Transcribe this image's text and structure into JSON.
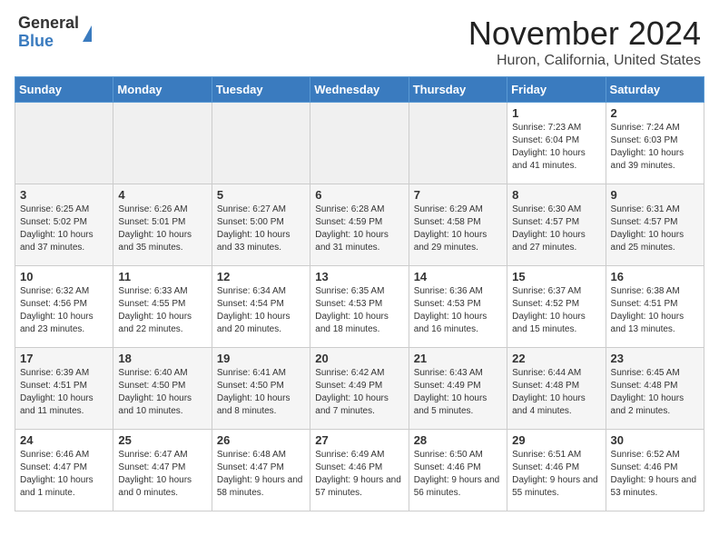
{
  "header": {
    "logo_line1": "General",
    "logo_line2": "Blue",
    "title": "November 2024",
    "subtitle": "Huron, California, United States"
  },
  "weekdays": [
    "Sunday",
    "Monday",
    "Tuesday",
    "Wednesday",
    "Thursday",
    "Friday",
    "Saturday"
  ],
  "weeks": [
    [
      {
        "day": "",
        "info": "",
        "empty": true
      },
      {
        "day": "",
        "info": "",
        "empty": true
      },
      {
        "day": "",
        "info": "",
        "empty": true
      },
      {
        "day": "",
        "info": "",
        "empty": true
      },
      {
        "day": "",
        "info": "",
        "empty": true
      },
      {
        "day": "1",
        "info": "Sunrise: 7:23 AM\nSunset: 6:04 PM\nDaylight: 10 hours and 41 minutes."
      },
      {
        "day": "2",
        "info": "Sunrise: 7:24 AM\nSunset: 6:03 PM\nDaylight: 10 hours and 39 minutes."
      }
    ],
    [
      {
        "day": "3",
        "info": "Sunrise: 6:25 AM\nSunset: 5:02 PM\nDaylight: 10 hours and 37 minutes."
      },
      {
        "day": "4",
        "info": "Sunrise: 6:26 AM\nSunset: 5:01 PM\nDaylight: 10 hours and 35 minutes."
      },
      {
        "day": "5",
        "info": "Sunrise: 6:27 AM\nSunset: 5:00 PM\nDaylight: 10 hours and 33 minutes."
      },
      {
        "day": "6",
        "info": "Sunrise: 6:28 AM\nSunset: 4:59 PM\nDaylight: 10 hours and 31 minutes."
      },
      {
        "day": "7",
        "info": "Sunrise: 6:29 AM\nSunset: 4:58 PM\nDaylight: 10 hours and 29 minutes."
      },
      {
        "day": "8",
        "info": "Sunrise: 6:30 AM\nSunset: 4:57 PM\nDaylight: 10 hours and 27 minutes."
      },
      {
        "day": "9",
        "info": "Sunrise: 6:31 AM\nSunset: 4:57 PM\nDaylight: 10 hours and 25 minutes."
      }
    ],
    [
      {
        "day": "10",
        "info": "Sunrise: 6:32 AM\nSunset: 4:56 PM\nDaylight: 10 hours and 23 minutes."
      },
      {
        "day": "11",
        "info": "Sunrise: 6:33 AM\nSunset: 4:55 PM\nDaylight: 10 hours and 22 minutes."
      },
      {
        "day": "12",
        "info": "Sunrise: 6:34 AM\nSunset: 4:54 PM\nDaylight: 10 hours and 20 minutes."
      },
      {
        "day": "13",
        "info": "Sunrise: 6:35 AM\nSunset: 4:53 PM\nDaylight: 10 hours and 18 minutes."
      },
      {
        "day": "14",
        "info": "Sunrise: 6:36 AM\nSunset: 4:53 PM\nDaylight: 10 hours and 16 minutes."
      },
      {
        "day": "15",
        "info": "Sunrise: 6:37 AM\nSunset: 4:52 PM\nDaylight: 10 hours and 15 minutes."
      },
      {
        "day": "16",
        "info": "Sunrise: 6:38 AM\nSunset: 4:51 PM\nDaylight: 10 hours and 13 minutes."
      }
    ],
    [
      {
        "day": "17",
        "info": "Sunrise: 6:39 AM\nSunset: 4:51 PM\nDaylight: 10 hours and 11 minutes."
      },
      {
        "day": "18",
        "info": "Sunrise: 6:40 AM\nSunset: 4:50 PM\nDaylight: 10 hours and 10 minutes."
      },
      {
        "day": "19",
        "info": "Sunrise: 6:41 AM\nSunset: 4:50 PM\nDaylight: 10 hours and 8 minutes."
      },
      {
        "day": "20",
        "info": "Sunrise: 6:42 AM\nSunset: 4:49 PM\nDaylight: 10 hours and 7 minutes."
      },
      {
        "day": "21",
        "info": "Sunrise: 6:43 AM\nSunset: 4:49 PM\nDaylight: 10 hours and 5 minutes."
      },
      {
        "day": "22",
        "info": "Sunrise: 6:44 AM\nSunset: 4:48 PM\nDaylight: 10 hours and 4 minutes."
      },
      {
        "day": "23",
        "info": "Sunrise: 6:45 AM\nSunset: 4:48 PM\nDaylight: 10 hours and 2 minutes."
      }
    ],
    [
      {
        "day": "24",
        "info": "Sunrise: 6:46 AM\nSunset: 4:47 PM\nDaylight: 10 hours and 1 minute."
      },
      {
        "day": "25",
        "info": "Sunrise: 6:47 AM\nSunset: 4:47 PM\nDaylight: 10 hours and 0 minutes."
      },
      {
        "day": "26",
        "info": "Sunrise: 6:48 AM\nSunset: 4:47 PM\nDaylight: 9 hours and 58 minutes."
      },
      {
        "day": "27",
        "info": "Sunrise: 6:49 AM\nSunset: 4:46 PM\nDaylight: 9 hours and 57 minutes."
      },
      {
        "day": "28",
        "info": "Sunrise: 6:50 AM\nSunset: 4:46 PM\nDaylight: 9 hours and 56 minutes."
      },
      {
        "day": "29",
        "info": "Sunrise: 6:51 AM\nSunset: 4:46 PM\nDaylight: 9 hours and 55 minutes."
      },
      {
        "day": "30",
        "info": "Sunrise: 6:52 AM\nSunset: 4:46 PM\nDaylight: 9 hours and 53 minutes."
      }
    ]
  ]
}
